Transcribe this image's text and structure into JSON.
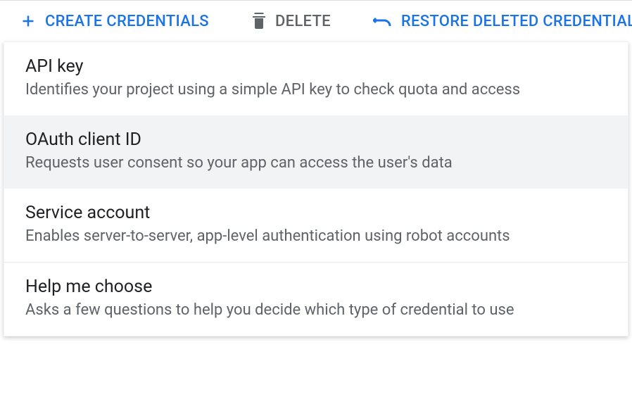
{
  "toolbar": {
    "create_label": "CREATE CREDENTIALS",
    "delete_label": "DELETE",
    "restore_label": "RESTORE DELETED CREDENTIALS"
  },
  "dropdown": {
    "items": [
      {
        "title": "API key",
        "desc": "Identifies your project using a simple API key to check quota and access"
      },
      {
        "title": "OAuth client ID",
        "desc": "Requests user consent so your app can access the user's data"
      },
      {
        "title": "Service account",
        "desc": "Enables server-to-server, app-level authentication using robot accounts"
      },
      {
        "title": "Help me choose",
        "desc": "Asks a few questions to help you decide which type of credential to use"
      }
    ]
  }
}
